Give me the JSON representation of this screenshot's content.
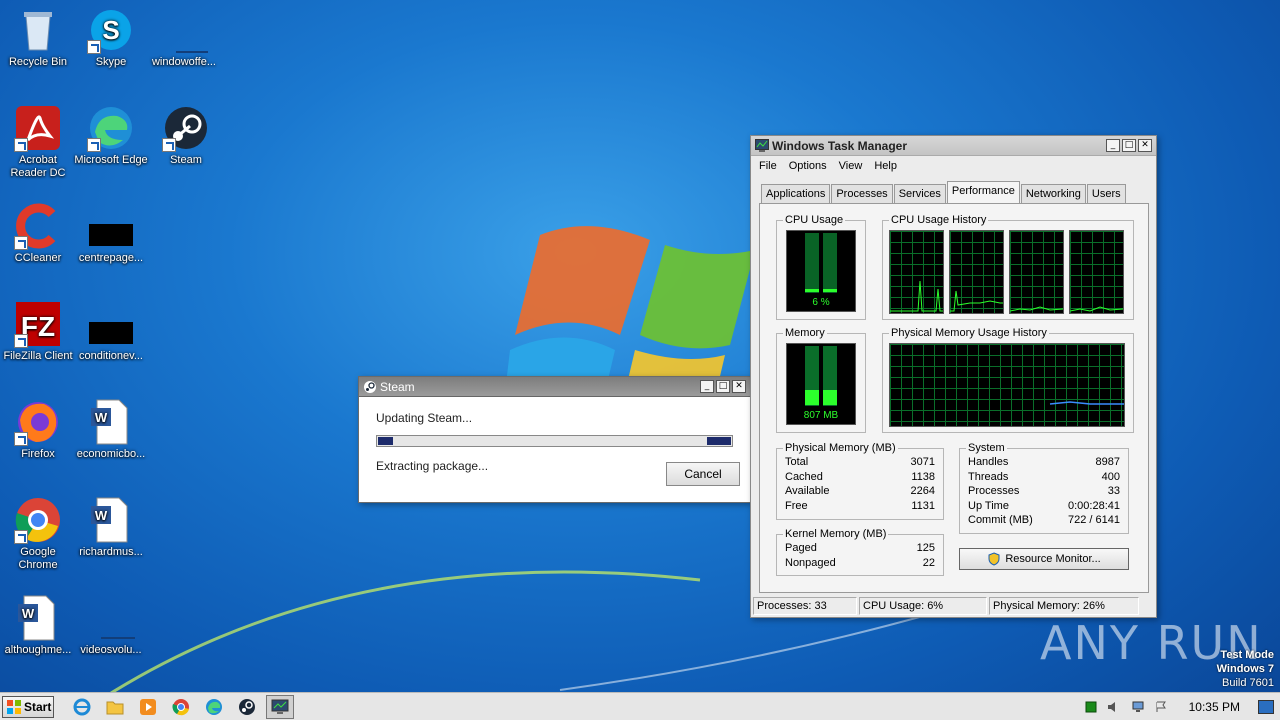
{
  "desktop": {
    "icons": [
      {
        "label": "Recycle Bin",
        "icon": "recycle-bin-icon"
      },
      {
        "label": "Skype",
        "icon": "skype-icon"
      },
      {
        "label": "windowoffe...",
        "icon": "blank-file-icon"
      },
      {
        "label": "Acrobat Reader DC",
        "icon": "acrobat-icon"
      },
      {
        "label": "Microsoft Edge",
        "icon": "edge-icon"
      },
      {
        "label": "Steam",
        "icon": "steam-icon"
      },
      {
        "label": "CCleaner",
        "icon": "ccleaner-icon"
      },
      {
        "label": "centrepage...",
        "icon": "black-file-icon"
      },
      {
        "label": "FileZilla Client",
        "icon": "filezilla-icon"
      },
      {
        "label": "conditionev...",
        "icon": "black-file-icon"
      },
      {
        "label": "Firefox",
        "icon": "firefox-icon"
      },
      {
        "label": "economicbo...",
        "icon": "word-doc-icon"
      },
      {
        "label": "Google Chrome",
        "icon": "chrome-icon"
      },
      {
        "label": "richardmus...",
        "icon": "word-doc-icon"
      },
      {
        "label": "althoughme...",
        "icon": "word-doc-icon"
      },
      {
        "label": "videosvolu...",
        "icon": "blank-file-icon"
      }
    ]
  },
  "steam_dialog": {
    "title": "Steam",
    "status": "Updating Steam...",
    "detail": "Extracting package...",
    "cancel_label": "Cancel",
    "progress": 0.05
  },
  "task_manager": {
    "title": "Windows Task Manager",
    "menu": [
      "File",
      "Options",
      "View",
      "Help"
    ],
    "tabs": [
      "Applications",
      "Processes",
      "Services",
      "Performance",
      "Networking",
      "Users"
    ],
    "active_tab": "Performance",
    "cpu_usage_label": "CPU Usage",
    "cpu_usage_value": "6 %",
    "cpu_history_label": "CPU Usage History",
    "memory_label": "Memory",
    "memory_value": "807 MB",
    "mem_history_label": "Physical Memory Usage History",
    "physical_memory": {
      "label": "Physical Memory (MB)",
      "rows": [
        {
          "k": "Total",
          "v": "3071"
        },
        {
          "k": "Cached",
          "v": "1138"
        },
        {
          "k": "Available",
          "v": "2264"
        },
        {
          "k": "Free",
          "v": "1131"
        }
      ]
    },
    "system": {
      "label": "System",
      "rows": [
        {
          "k": "Handles",
          "v": "8987"
        },
        {
          "k": "Threads",
          "v": "400"
        },
        {
          "k": "Processes",
          "v": "33"
        },
        {
          "k": "Up Time",
          "v": "0:00:28:41"
        },
        {
          "k": "Commit (MB)",
          "v": "722 / 6141"
        }
      ]
    },
    "kernel_memory": {
      "label": "Kernel Memory (MB)",
      "rows": [
        {
          "k": "Paged",
          "v": "125"
        },
        {
          "k": "Nonpaged",
          "v": "22"
        }
      ]
    },
    "resource_monitor_label": "Resource Monitor...",
    "status": {
      "processes": "Processes: 33",
      "cpu": "CPU Usage: 6%",
      "memory": "Physical Memory: 26%"
    }
  },
  "taskbar": {
    "start_label": "Start",
    "clock": "10:35 PM",
    "pinned": [
      "ie-icon",
      "explorer-icon",
      "media-player-icon",
      "chrome-icon",
      "edge-icon",
      "steam-icon",
      "task-manager-icon"
    ]
  },
  "watermark": "ANY RUN",
  "os_info": {
    "line1": "Test Mode",
    "line2": "Windows 7",
    "line3": "Build 7601"
  }
}
